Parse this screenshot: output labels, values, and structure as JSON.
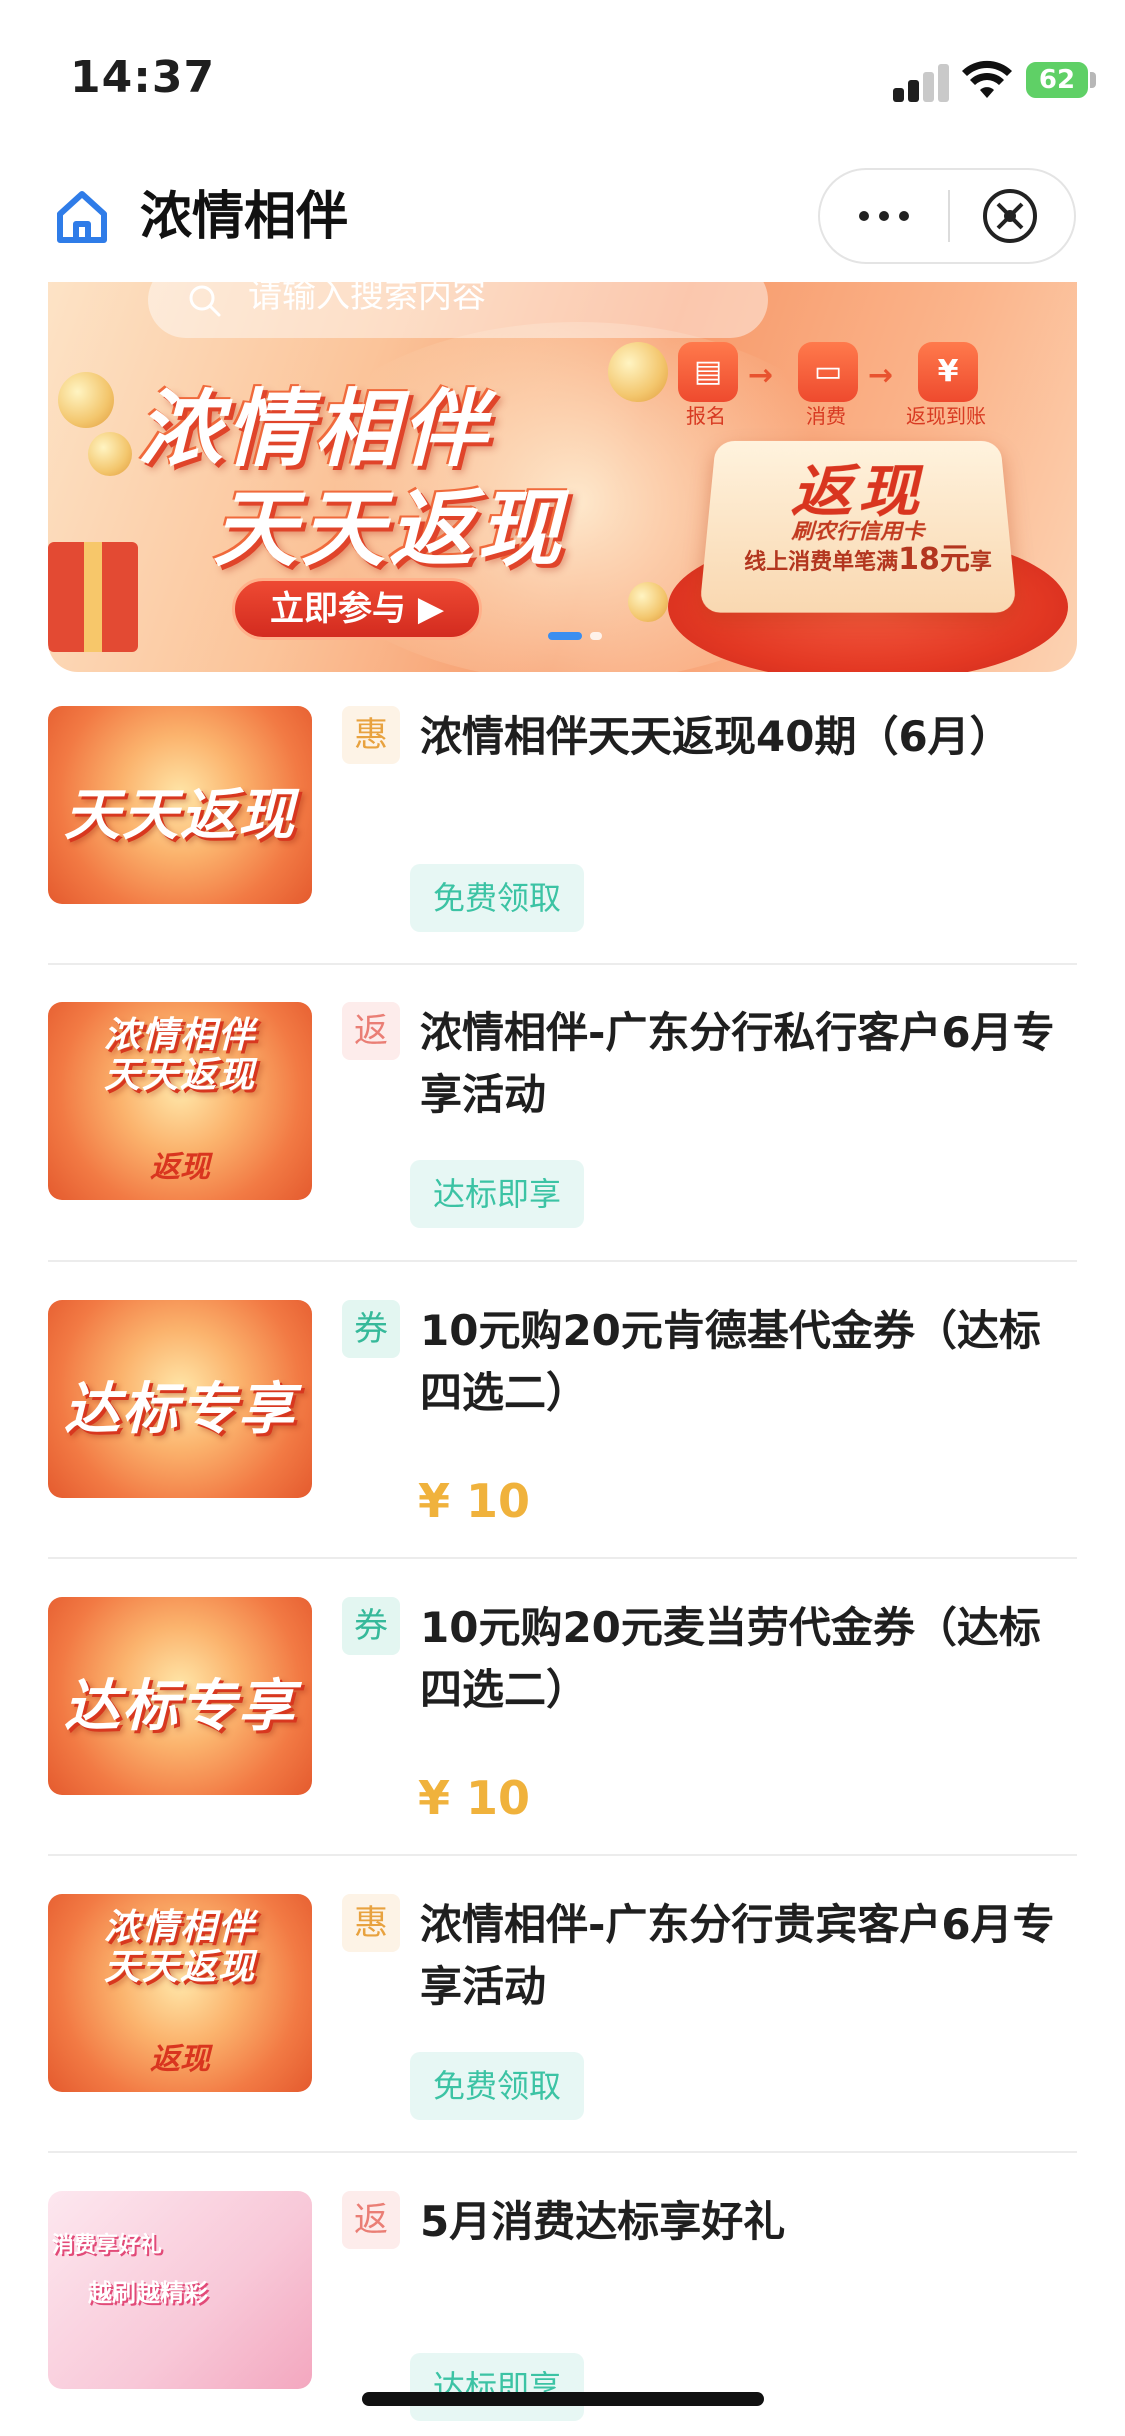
{
  "status_bar": {
    "time": "14:37",
    "battery": "62"
  },
  "nav": {
    "title": "浓情相伴"
  },
  "banner": {
    "search_placeholder": "请输入搜索内容",
    "title_line1": "浓情相伴",
    "title_line2": "天天返现",
    "join_button": "立即参与 ▶",
    "steps": [
      "报名",
      "消费",
      "返现到账"
    ],
    "card_title": "返现",
    "card_subtitle": "刷农行信用卡",
    "card_note_prefix": "线上消费单笔满",
    "card_note_amount": "18元",
    "card_note_suffix": "享",
    "active_slide": 0,
    "slide_count": 2
  },
  "items": [
    {
      "tag": "惠",
      "title": "浓情相伴天天返现40期（6月）",
      "action": "免费领取",
      "thumb_text": "天天返现"
    },
    {
      "tag": "返",
      "title": "浓情相伴-广东分行私行客户6月专享活动",
      "action": "达标即享",
      "thumb_text_1": "浓情相伴",
      "thumb_text_2": "天天返现",
      "thumb_card": "返现"
    },
    {
      "tag": "券",
      "title": "10元购20元肯德基代金券（达标四选二）",
      "price": "¥ 10",
      "thumb_text": "达标专享"
    },
    {
      "tag": "券",
      "title": "10元购20元麦当劳代金券（达标四选二）",
      "price": "¥ 10",
      "thumb_text": "达标专享"
    },
    {
      "tag": "惠",
      "title": "浓情相伴-广东分行贵宾客户6月专享活动",
      "action": "免费领取",
      "thumb_text_1": "浓情相伴",
      "thumb_text_2": "天天返现",
      "thumb_card": "返现"
    },
    {
      "tag": "返",
      "title": "5月消费达标享好礼",
      "action": "达标即享",
      "thumb_text_1": "消费享好礼",
      "thumb_text_2": "越刷越精彩"
    }
  ]
}
